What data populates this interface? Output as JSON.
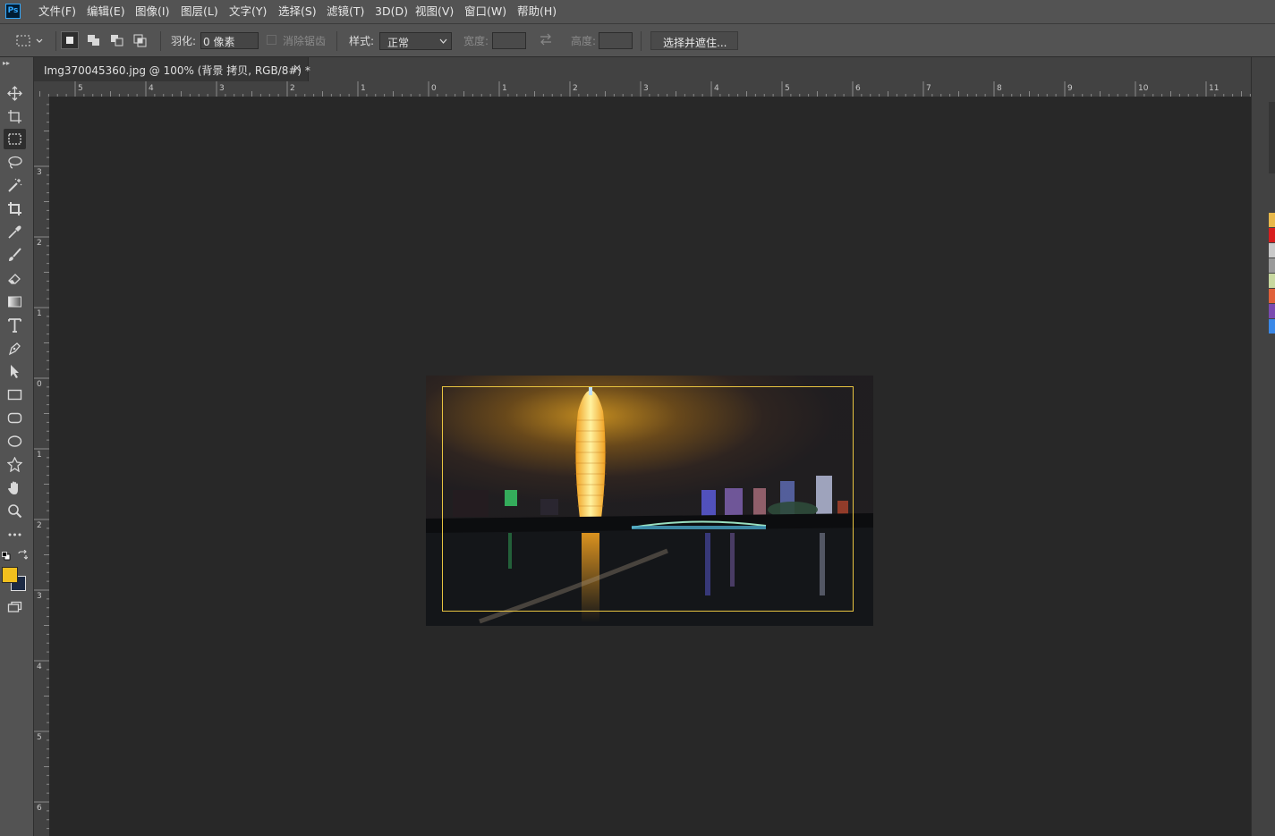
{
  "app": {
    "logo": "Ps"
  },
  "menu": [
    {
      "label": "文件(F)"
    },
    {
      "label": "编辑(E)"
    },
    {
      "label": "图像(I)"
    },
    {
      "label": "图层(L)"
    },
    {
      "label": "文字(Y)"
    },
    {
      "label": "选择(S)"
    },
    {
      "label": "滤镜(T)"
    },
    {
      "label": "3D(D)"
    },
    {
      "label": "视图(V)"
    },
    {
      "label": "窗口(W)"
    },
    {
      "label": "帮助(H)"
    }
  ],
  "options": {
    "feather_label": "羽化:",
    "feather_value": "0 像素",
    "antialias_label": "消除锯齿",
    "style_label": "样式:",
    "style_value": "正常",
    "width_label": "宽度:",
    "height_label": "高度:",
    "select_mask_label": "选择并遮住..."
  },
  "document": {
    "tab_title": "Img370045360.jpg @ 100% (背景 拷贝, RGB/8#) *",
    "close_glyph": "×"
  },
  "rulers": {
    "top": [
      "5",
      "4",
      "3",
      "2",
      "1",
      "0",
      "1",
      "2",
      "3",
      "4",
      "5",
      "6",
      "7",
      "8",
      "9",
      "10",
      "11"
    ],
    "left": [
      "3",
      "2",
      "1",
      "0",
      "1",
      "2",
      "3",
      "4",
      "5",
      "6"
    ]
  },
  "colors": {
    "foreground": "#f2c01e",
    "background": "#1c2a44",
    "selection": "#e8c441",
    "accent": "#31a8ff"
  },
  "swatches": [
    "#e8b84a",
    "#d81e1e",
    "#c9c9c9",
    "#9a9a9a",
    "#c8d8a0",
    "#e0603a",
    "#7a4ab0",
    "#3a88e8"
  ],
  "tools": [
    "move-tool-icon",
    "artboard-tool-icon",
    "rect-marquee-icon",
    "lasso-icon",
    "magic-wand-icon",
    "crop-icon",
    "eyedropper-icon",
    "brush-icon",
    "eraser-icon",
    "gradient-icon",
    "type-icon",
    "pen-icon",
    "path-select-icon",
    "rectangle-shape-icon",
    "rounded-rect-icon",
    "ellipse-icon",
    "polygon-icon",
    "hand-icon",
    "zoom-icon",
    "more-tools-icon"
  ]
}
